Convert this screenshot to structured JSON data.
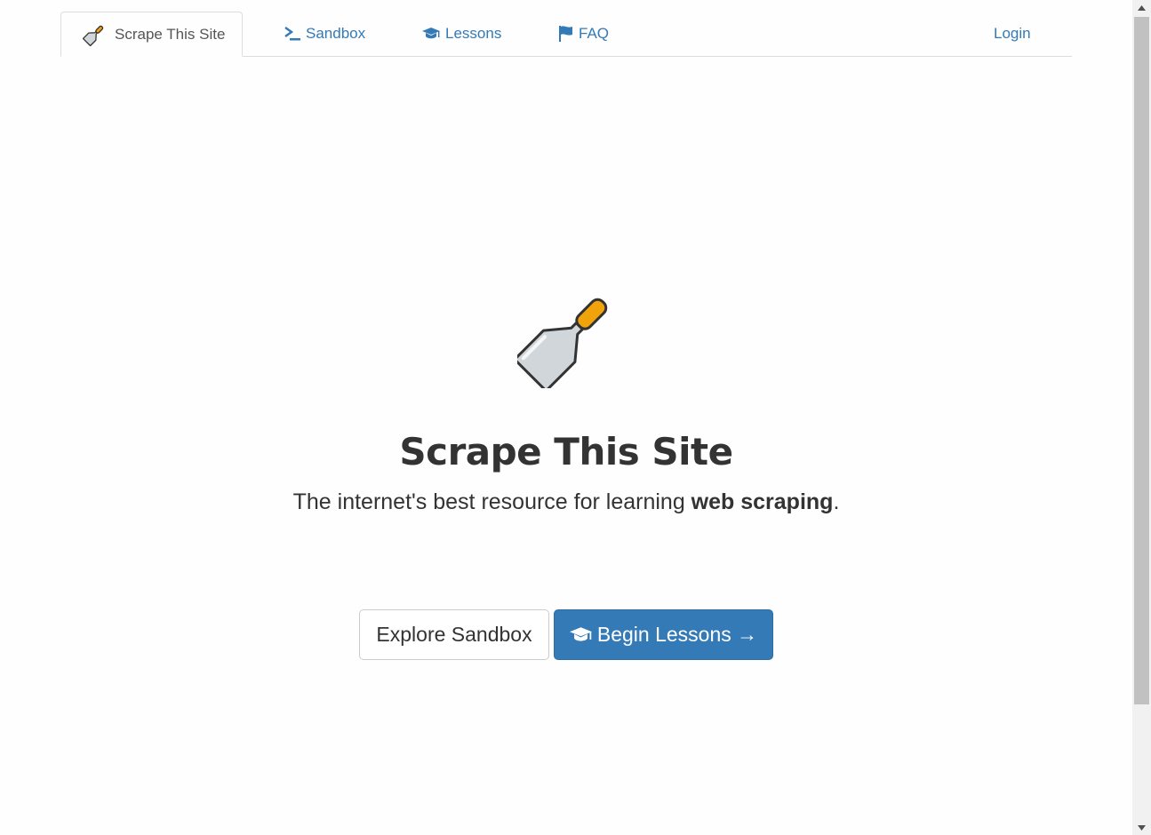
{
  "nav": {
    "brand_label": "Scrape This Site",
    "items": [
      {
        "label": "Sandbox",
        "icon": "terminal-icon"
      },
      {
        "label": "Lessons",
        "icon": "graduation-cap-icon"
      },
      {
        "label": "FAQ",
        "icon": "flag-icon"
      }
    ],
    "login_label": "Login"
  },
  "hero": {
    "title": "Scrape This Site",
    "subtitle_prefix": "The internet's best resource for learning ",
    "subtitle_bold": "web scraping",
    "subtitle_suffix": ".",
    "explore_button": "Explore Sandbox",
    "lessons_button": "Begin Lessons →"
  },
  "colors": {
    "link": "#337ab7",
    "primary_button": "#337ab7",
    "scraper_handle": "#f0a30a",
    "scraper_blade": "#d1d6db"
  }
}
